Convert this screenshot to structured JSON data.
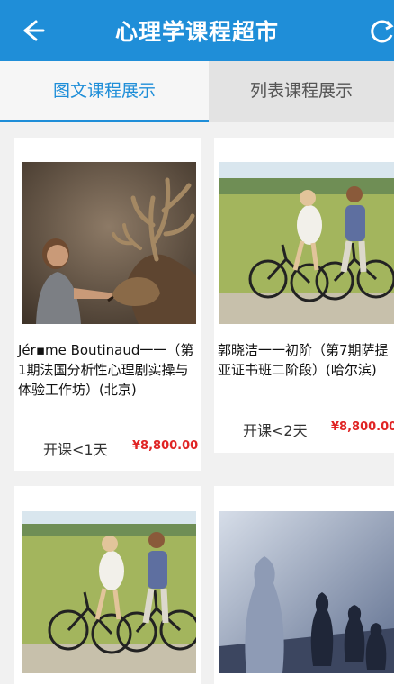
{
  "header": {
    "title": "心理学课程超市",
    "back_icon": "back-arrow-icon",
    "refresh_icon": "refresh-icon",
    "bg_color": "#1f8ed8"
  },
  "tabs": [
    {
      "label": "图文课程展示",
      "active": true
    },
    {
      "label": "列表课程展示",
      "active": false
    }
  ],
  "courses": [
    {
      "name": "Jér▪me Boutinaud一一（第1期法国分析性心理剧实操与体验工作坊）(北京)",
      "start": "开课<1天",
      "price": "¥8,800.00"
    },
    {
      "name": "郭晓洁一一初阶（第7期萨提亚证书班二阶段）(哈尔滨)",
      "start": "开课<2天",
      "price": "¥8,800.00"
    },
    {
      "name": "",
      "start": "",
      "price": ""
    },
    {
      "name": "",
      "start": "",
      "price": ""
    }
  ]
}
